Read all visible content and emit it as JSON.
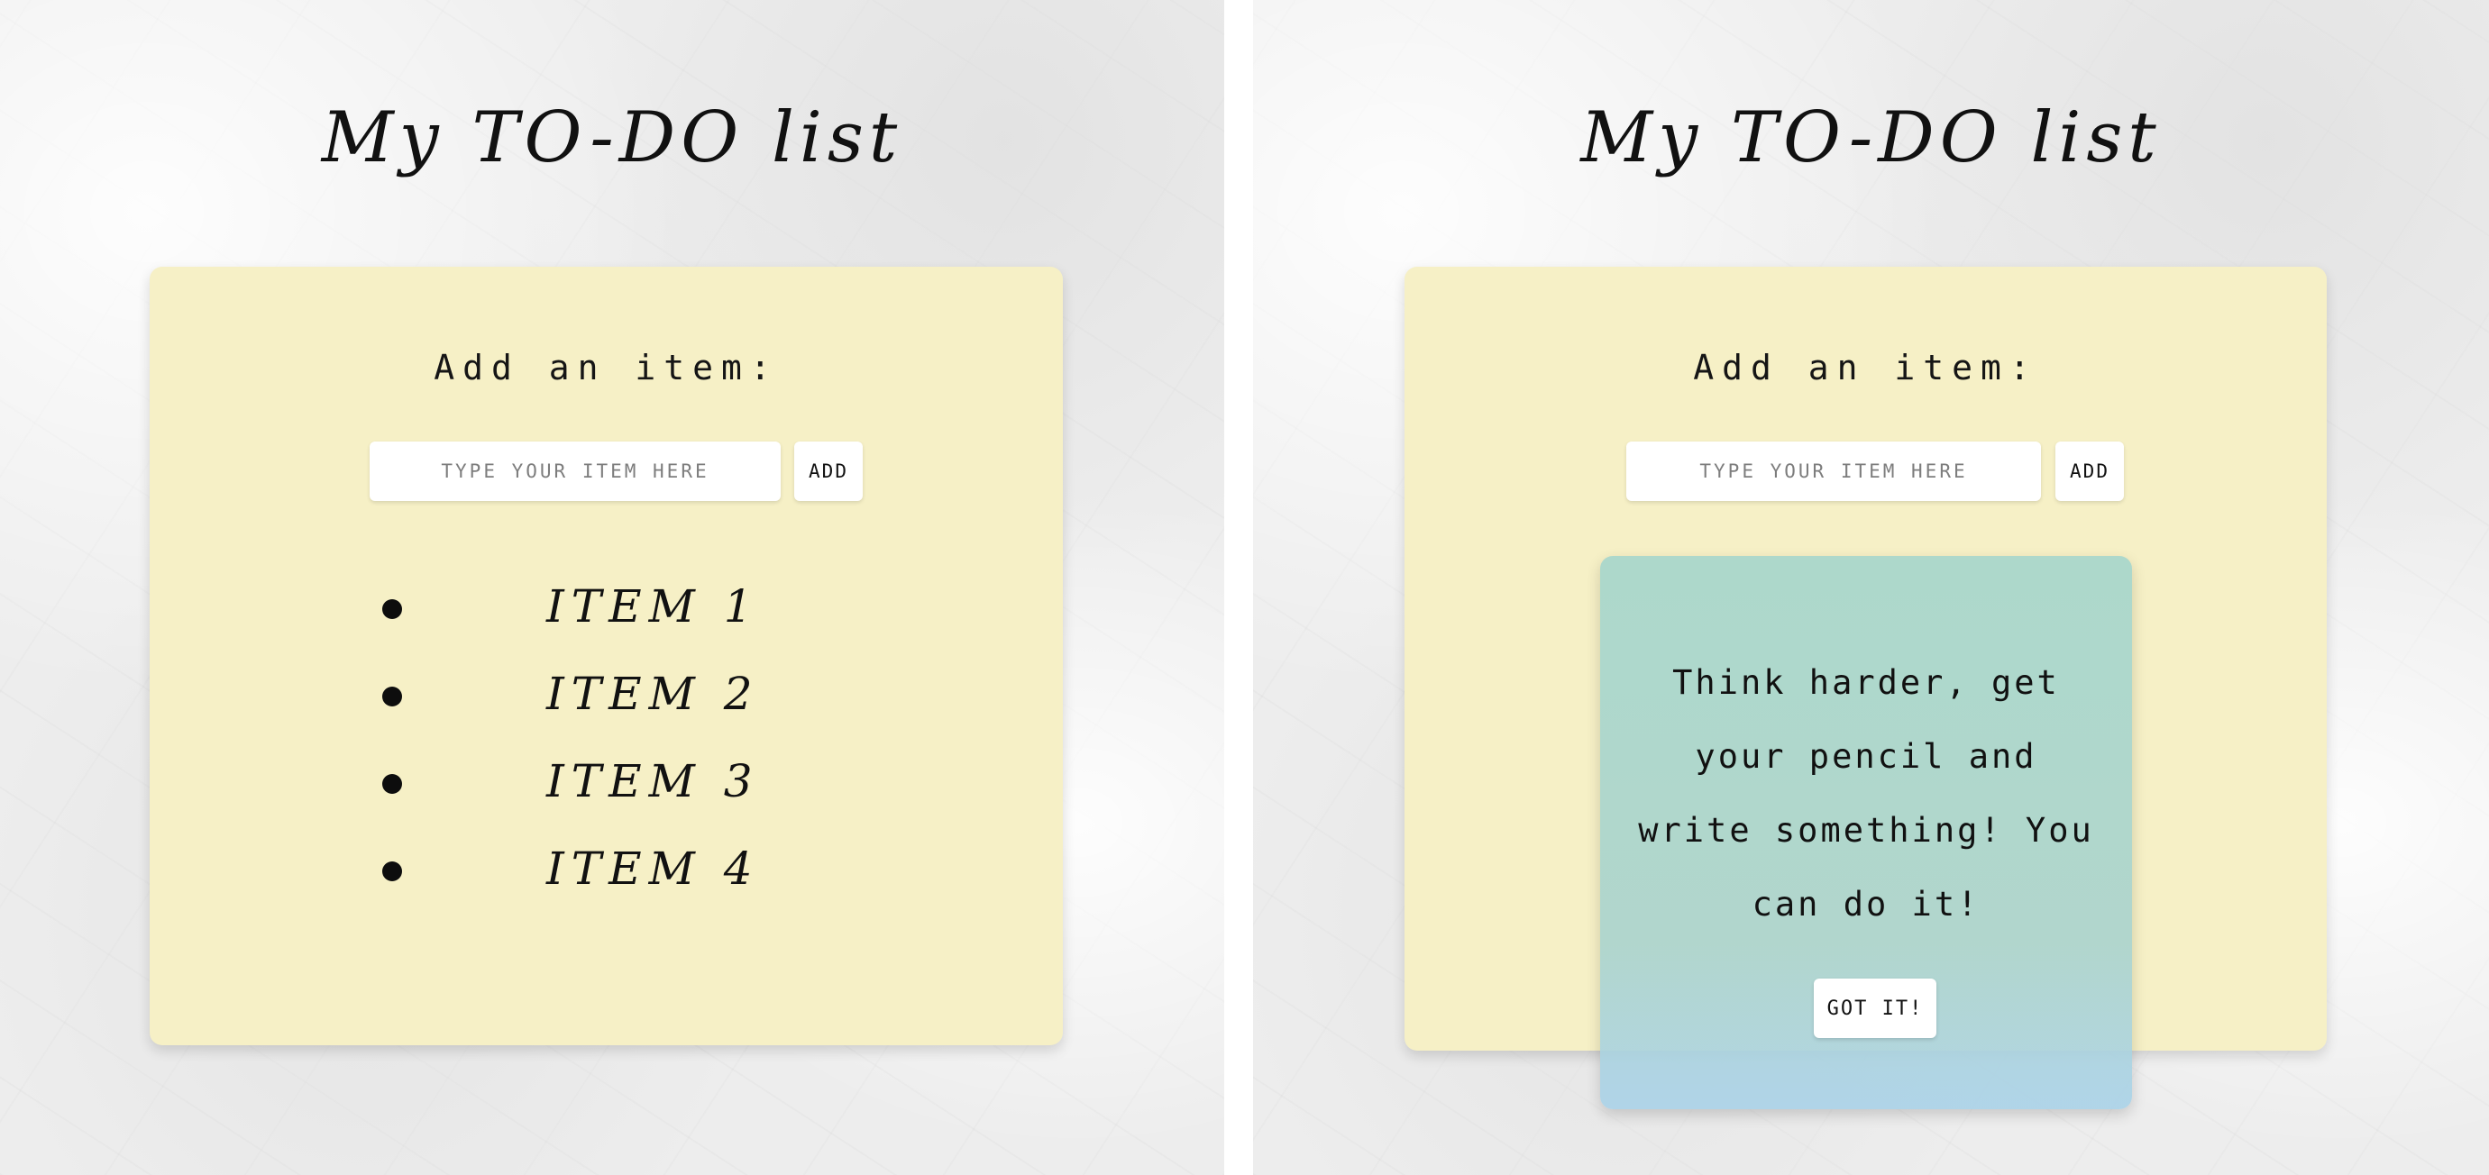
{
  "left_screen": {
    "title": "My TO-DO list",
    "add_label": "Add an item:",
    "input": {
      "placeholder": "TYPE YOUR ITEM HERE",
      "value": ""
    },
    "add_button_label": "ADD",
    "items": [
      {
        "text": "ITEM 1"
      },
      {
        "text": "ITEM 2"
      },
      {
        "text": "ITEM 3"
      },
      {
        "text": "ITEM 4"
      }
    ]
  },
  "right_screen": {
    "title": "My TO-DO list",
    "add_label": "Add an item:",
    "input": {
      "placeholder": "TYPE YOUR ITEM HERE",
      "value": ""
    },
    "add_button_label": "ADD",
    "modal": {
      "message": "Think harder, get your pencil and write something! You can do it!",
      "button_label": "GOT IT!"
    }
  },
  "colors": {
    "sticky_note": "#f6f0c6",
    "modal": "#a5d3cd",
    "background": "#ededed",
    "text": "#111111"
  }
}
